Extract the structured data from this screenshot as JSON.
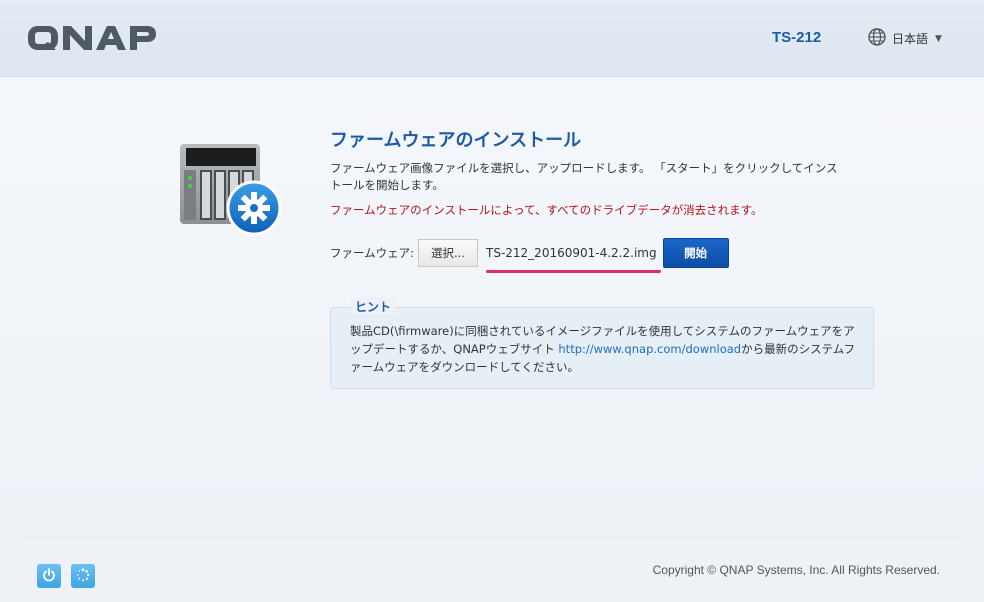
{
  "header": {
    "logo_text": "QNAP",
    "model": "TS-212",
    "language": "日本語",
    "globe_icon": "globe-icon",
    "caret_icon": "chevron-down-icon"
  },
  "page": {
    "title": "ファームウェアのインストール",
    "description_line1": "ファームウェア画像ファイルを選択し、アップロードします。 「スタート」をクリックしてインス",
    "description_line2": "トールを開始します。",
    "warning": "ファームウェアのインストールによって、すべてのドライブデータが消去されます。"
  },
  "firmware": {
    "label": "ファームウェア:",
    "browse_label": "選択...",
    "filename": "TS-212_20160901-4.2.2.img",
    "start_label": "開始"
  },
  "hint": {
    "title": "ヒント",
    "text_part1": "製品CD(\\firmware)に同梱されているイメージファイルを使用してシステムのファームウェア",
    "text_part2": "をアップデートするか、QNAPウェブサイト ",
    "link": "http://www.qnap.com/download",
    "text_part3": "から最新のシ",
    "text_part4": "ステムファームウェアをダウンロードしてください。"
  },
  "footer": {
    "copyright": "Copyright © QNAP Systems, Inc. All Rights Reserved.",
    "power_icon": "power-icon",
    "loading_icon": "loading-icon"
  },
  "colors": {
    "accent": "#1d5aa8",
    "warning": "#b0141a",
    "highlight": "#d92f6b",
    "start_button": "#1b66c9"
  }
}
